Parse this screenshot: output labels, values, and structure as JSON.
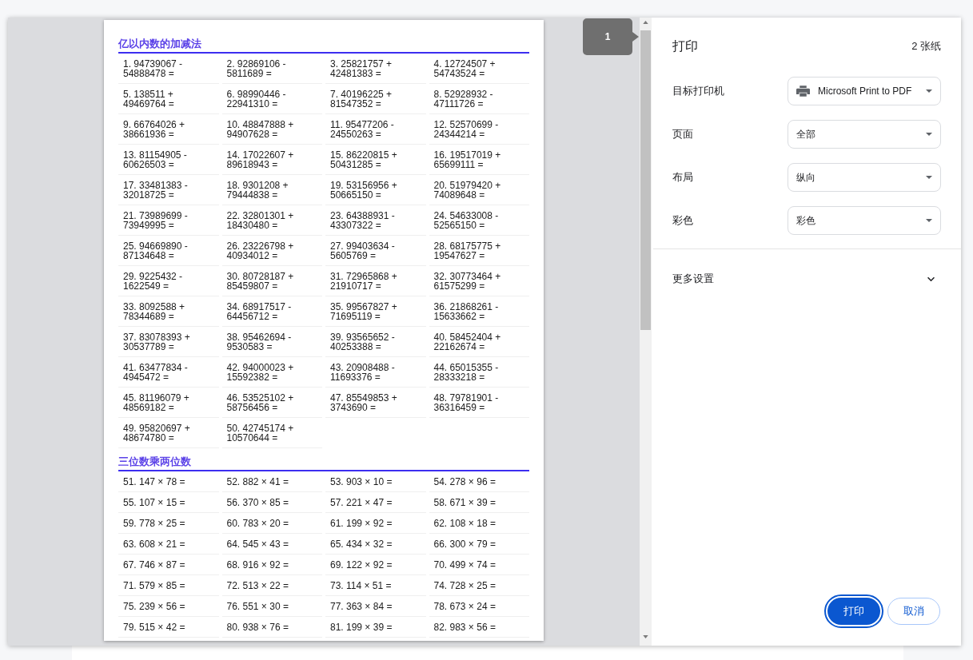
{
  "print_preview": {
    "page_badge": "1",
    "sections": [
      {
        "title": "亿以内数的加减法",
        "problems": [
          "1. 94739067 - 54888478 =",
          "2. 92869106 - 5811689 =",
          "3. 25821757 + 42481383 =",
          "4. 12724507 + 54743524 =",
          "5. 138511 + 49469764 =",
          "6. 98990446 - 22941310 =",
          "7. 40196225 + 81547352 =",
          "8. 52928932 - 47111726 =",
          "9. 66764026 + 38661936 =",
          "10. 48847888 + 94907628 =",
          "11. 95477206 - 24550263 =",
          "12. 52570699 - 24344214 =",
          "13. 81154905 - 60626503 =",
          "14. 17022607 + 89618943 =",
          "15. 86220815 + 50431285 =",
          "16. 19517019 + 65699111 =",
          "17. 33481383 - 32018725 =",
          "18. 9301208 + 79444838 =",
          "19. 53156956 + 50665150 =",
          "20. 51979420 + 74089648 =",
          "21. 73989699 - 73949995 =",
          "22. 32801301 + 18430480 =",
          "23. 64388931 - 43307322 =",
          "24. 54633008 - 52565150 =",
          "25. 94669890 - 87134648 =",
          "26. 23226798 + 40934012 =",
          "27. 99403634 - 5605769 =",
          "28. 68175775 + 19547627 =",
          "29. 9225432 - 1622549 =",
          "30. 80728187 + 85459807 =",
          "31. 72965868 + 21910717 =",
          "32. 30773464 + 61575299 =",
          "33. 8092588 + 78344689 =",
          "34. 68917517 - 64456712 =",
          "35. 99567827 + 71695119 =",
          "36. 21868261 - 15633662 =",
          "37. 83078393 + 30537789 =",
          "38. 95462694 - 9530583 =",
          "39. 93565652 - 40253388 =",
          "40. 58452404 + 22162674 =",
          "41. 63477834 - 4945472 =",
          "42. 94000023 + 15592382 =",
          "43. 20908488 - 11693376 =",
          "44. 65015355 - 28333218 =",
          "45. 81196079 + 48569182 =",
          "46. 53525102 + 58756456 =",
          "47. 85549853 + 3743690 =",
          "48. 79781901 - 36316459 =",
          "49. 95820697 + 48674780 =",
          "50. 42745174 + 10570644 ="
        ]
      },
      {
        "title": "三位数乘两位数",
        "problems": [
          "51. 147 × 78 =",
          "52. 882 × 41 =",
          "53. 903 × 10 =",
          "54. 278 × 96 =",
          "55. 107 × 15 =",
          "56. 370 × 85 =",
          "57. 221 × 47 =",
          "58. 671 × 39 =",
          "59. 778 × 25 =",
          "60. 783 × 20 =",
          "61. 199 × 92 =",
          "62. 108 × 18 =",
          "63. 608 × 21 =",
          "64. 545 × 43 =",
          "65. 434 × 32 =",
          "66. 300 × 79 =",
          "67. 746 × 87 =",
          "68. 916 × 92 =",
          "69. 122 × 92 =",
          "70. 499 × 74 =",
          "71. 579 × 85 =",
          "72. 513 × 22 =",
          "73. 114 × 51 =",
          "74. 728 × 25 =",
          "75. 239 × 56 =",
          "76. 551 × 30 =",
          "77. 363 × 84 =",
          "78. 673 × 24 =",
          "79. 515 × 42 =",
          "80. 938 × 76 =",
          "81. 199 × 39 =",
          "82. 983 × 56 ="
        ]
      }
    ]
  },
  "print_settings": {
    "title": "打印",
    "sheet_count": "2 张纸",
    "fields": [
      {
        "label": "目标打印机",
        "value": "Microsoft Print to PDF",
        "kind": "printer"
      },
      {
        "label": "页面",
        "value": "全部",
        "kind": "plain"
      },
      {
        "label": "布局",
        "value": "纵向",
        "kind": "plain"
      },
      {
        "label": "彩色",
        "value": "彩色",
        "kind": "plain"
      }
    ],
    "more_settings": {
      "label": "更多设置",
      "expanded": false
    },
    "buttons": [
      {
        "label": "打印",
        "kind": "primary",
        "focused": true
      },
      {
        "label": "取消",
        "kind": "secondary",
        "focused": false
      }
    ]
  }
}
